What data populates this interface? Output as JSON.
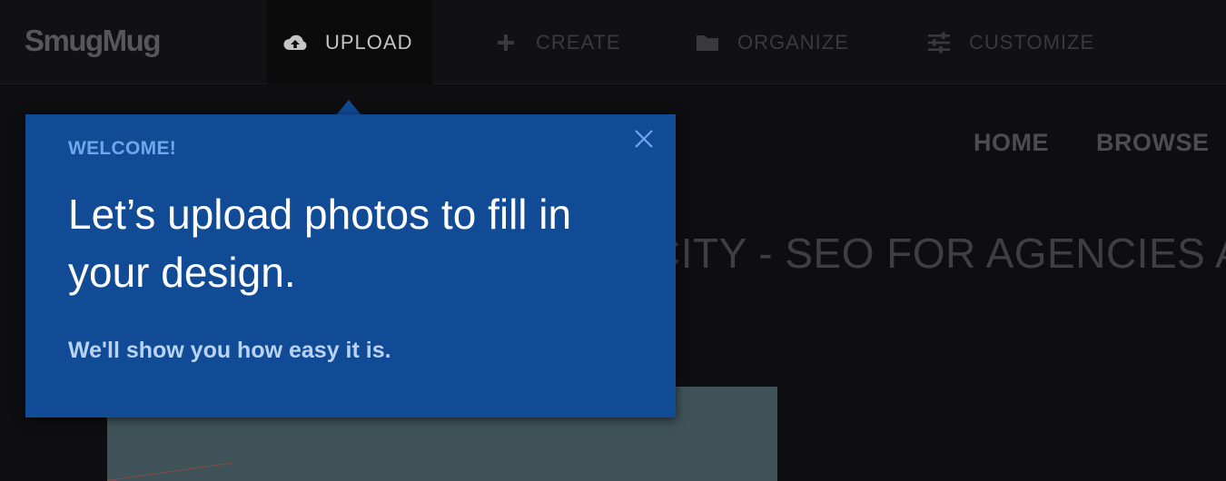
{
  "app": {
    "logo": "SmugMug"
  },
  "toolbar": {
    "items": [
      {
        "label": "UPLOAD",
        "icon": "cloud-upload-icon",
        "active": true
      },
      {
        "label": "CREATE",
        "icon": "plus-icon",
        "active": false
      },
      {
        "label": "ORGANIZE",
        "icon": "folder-icon",
        "active": false
      },
      {
        "label": "CUSTOMIZE",
        "icon": "sliders-icon",
        "active": false
      }
    ]
  },
  "site": {
    "nav": [
      {
        "label": "HOME"
      },
      {
        "label": "BROWSE"
      }
    ],
    "title": "CITY - SEO FOR AGENCIES A"
  },
  "popup": {
    "eyebrow": "WELCOME!",
    "headline": "Let’s upload photos to fill in your design.",
    "subtext": "We'll show you how easy it is.",
    "close_icon": "close-icon"
  },
  "colors": {
    "popup_bg": "#114a95",
    "eyebrow": "#6ea7ec",
    "subtext": "#b9d3f5",
    "page_bg": "#0e0e10"
  }
}
